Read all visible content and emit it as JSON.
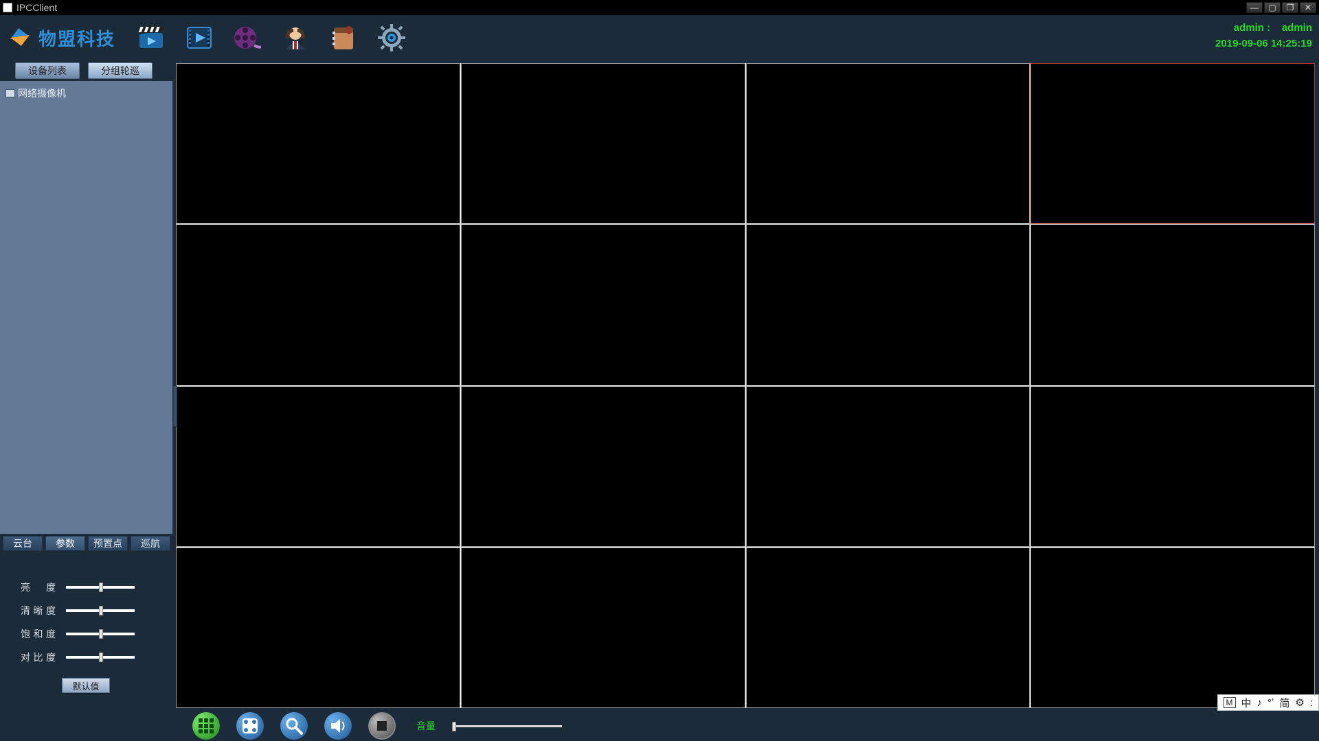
{
  "window": {
    "title": "IPCClient"
  },
  "brand": {
    "name": "物盟科技"
  },
  "toolbar_icons": [
    "clapper-icon",
    "play-file-icon",
    "film-reel-icon",
    "user-icon",
    "notebook-icon",
    "gear-eye-icon"
  ],
  "status": {
    "user_label": "admin :",
    "user_name": "admin",
    "datetime": "2019-09-06 14:25:19"
  },
  "sidebar": {
    "top_tabs": [
      {
        "label": "设备列表",
        "active": true
      },
      {
        "label": "分组轮巡",
        "active": false
      }
    ],
    "tree_root": "网络摄像机",
    "bottom_tabs": [
      {
        "label": "云台",
        "active": false
      },
      {
        "label": "参数",
        "active": true
      },
      {
        "label": "预置点",
        "active": false
      },
      {
        "label": "巡航",
        "active": false
      }
    ],
    "params": [
      {
        "label": "亮　度",
        "value": 50
      },
      {
        "label": "清晰度",
        "value": 50
      },
      {
        "label": "饱和度",
        "value": 50
      },
      {
        "label": "对比度",
        "value": 50
      }
    ],
    "defaults_btn": "默认值"
  },
  "grid": {
    "rows": 4,
    "cols": 4,
    "selected_index": 3
  },
  "bottom": {
    "buttons": [
      "layout-grid",
      "layout-switch",
      "probe",
      "audio-talk",
      "stop-all"
    ],
    "volume_label": "音量",
    "volume_value": 0
  },
  "ime": {
    "items": [
      "M",
      "中",
      "♪",
      "°ʼ",
      "简",
      "⚙",
      ":"
    ]
  }
}
